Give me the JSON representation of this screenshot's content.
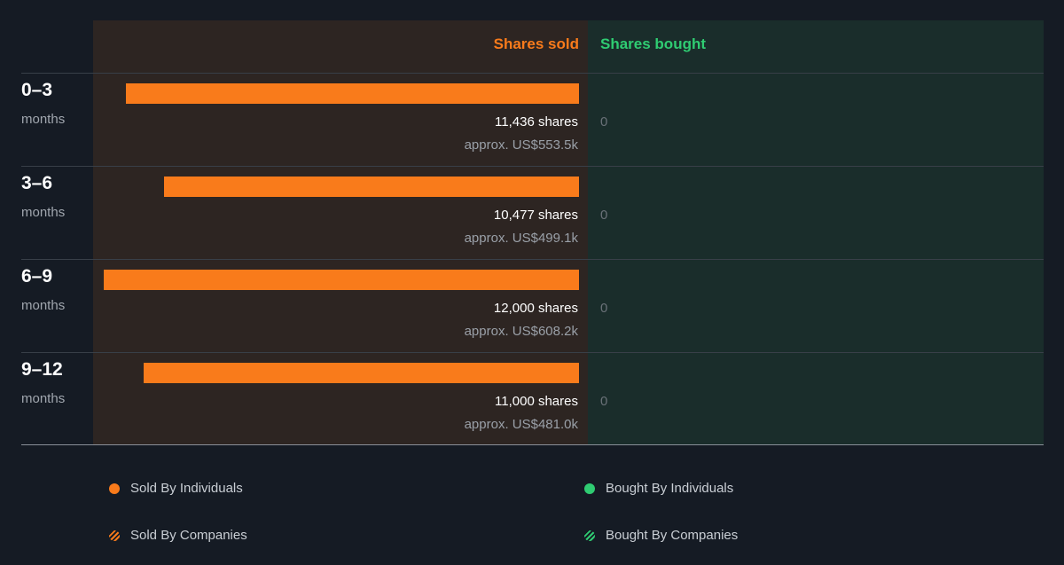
{
  "columns": {
    "sold": "Shares sold",
    "bought": "Shares bought"
  },
  "chart_data": {
    "type": "bar",
    "categories": [
      "0–3 months",
      "3–6 months",
      "6–9 months",
      "9–12 months"
    ],
    "series": [
      {
        "name": "Shares sold",
        "values": [
          11436,
          10477,
          12000,
          11000
        ]
      },
      {
        "name": "Shares bought",
        "values": [
          0,
          0,
          0,
          0
        ]
      }
    ]
  },
  "rows": [
    {
      "period": "0–3",
      "unit": "months",
      "shares": "11,436 shares",
      "approx": "approx. US$553.5k",
      "bought": "0"
    },
    {
      "period": "3–6",
      "unit": "months",
      "shares": "10,477 shares",
      "approx": "approx. US$499.1k",
      "bought": "0"
    },
    {
      "period": "6–9",
      "unit": "months",
      "shares": "12,000 shares",
      "approx": "approx. US$608.2k",
      "bought": "0"
    },
    {
      "period": "9–12",
      "unit": "months",
      "shares": "11,000 shares",
      "approx": "approx. US$481.0k",
      "bought": "0"
    }
  ],
  "legend": [
    {
      "label": "Sold By Individuals",
      "color": "#f97b1b",
      "style": "solid"
    },
    {
      "label": "Bought By Individuals",
      "color": "#2fcc72",
      "style": "solid"
    },
    {
      "label": "Sold By Companies",
      "color": "#f97b1b",
      "style": "striped"
    },
    {
      "label": "Bought By Companies",
      "color": "#2fcc72",
      "style": "striped"
    }
  ]
}
